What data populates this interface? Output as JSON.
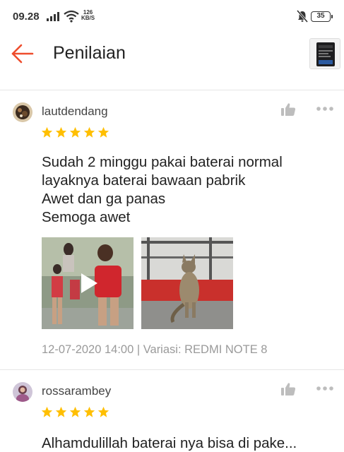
{
  "status_bar": {
    "time": "09.28",
    "net_speed_value": "126",
    "net_speed_unit": "KB/S",
    "battery_level": "35",
    "icons": [
      "signal-icon",
      "wifi-icon",
      "mute-icon",
      "battery-icon"
    ]
  },
  "header": {
    "title": "Penilaian",
    "back_icon": "arrow-left-icon",
    "accent_color": "#ee4d2d"
  },
  "reviews": [
    {
      "username": "lautdendang",
      "rating": 5,
      "text": "Sudah 2 minggu pakai baterai normal\nlayaknya baterai bawaan pabrik\nAwet dan ga panas\nSemoga awet",
      "media": [
        "video-thumbnail",
        "photo-thumbnail"
      ],
      "meta": "12-07-2020 14:00 | Variasi: REDMI NOTE 8"
    },
    {
      "username": "rossarambey",
      "rating": 5,
      "text": "Alhamdulillah baterai nya bisa di pake..."
    }
  ],
  "colors": {
    "star": "#ffbf00",
    "accent": "#ee4d2d",
    "meta_text": "#9a9a9a"
  }
}
